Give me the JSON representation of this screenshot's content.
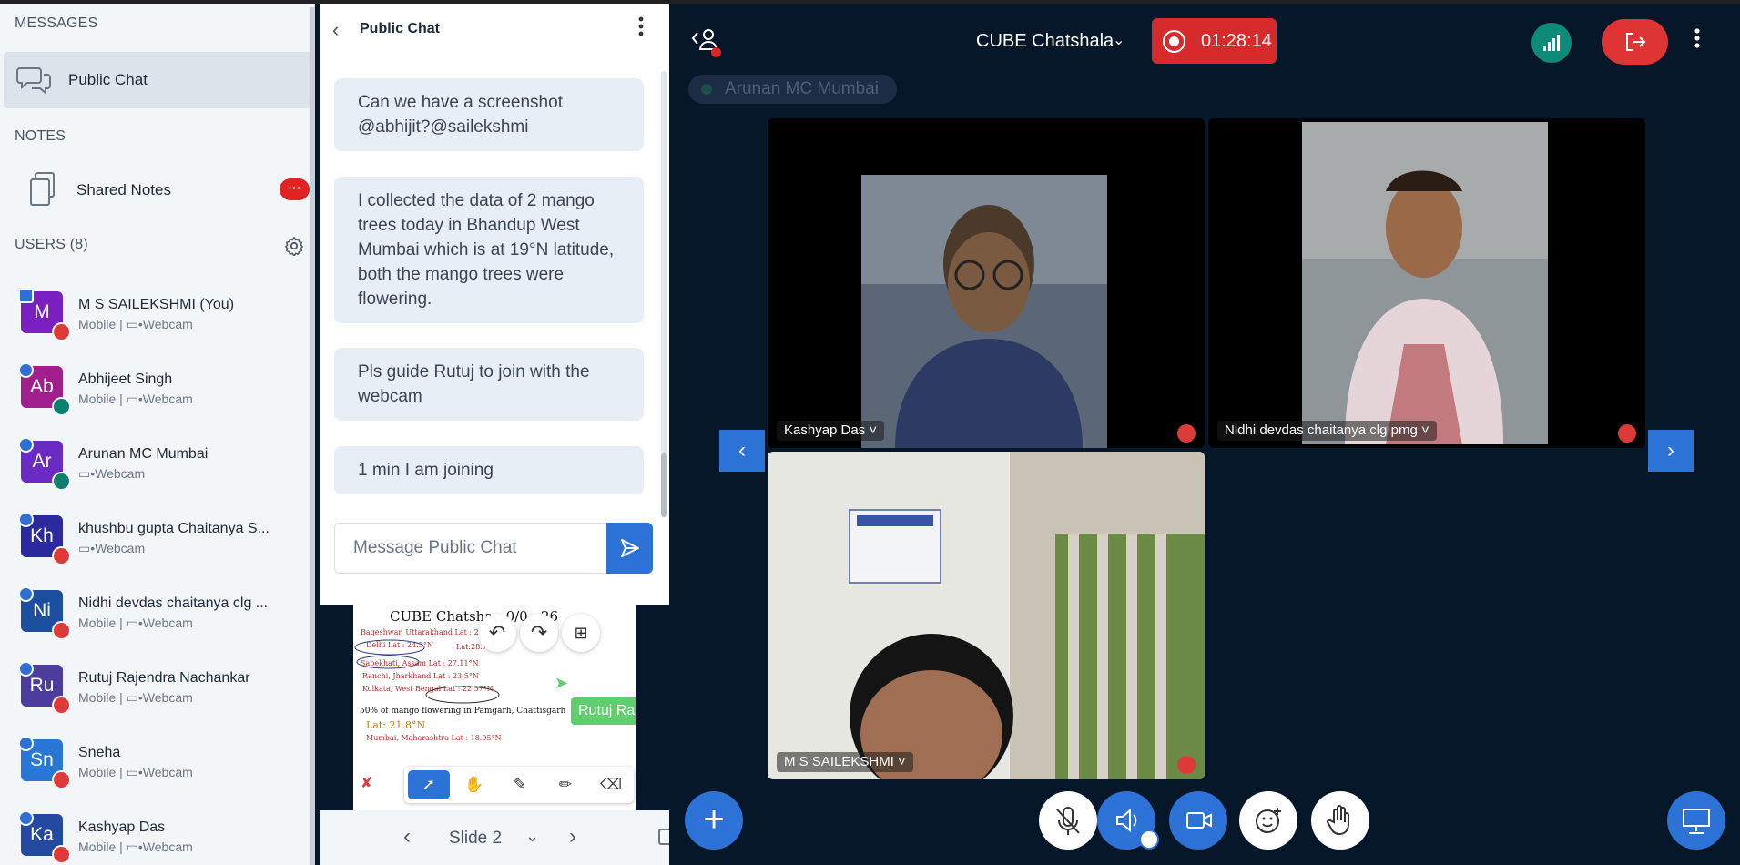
{
  "sidebar": {
    "messages_title": "MESSAGES",
    "public_chat_label": "Public Chat",
    "notes_title": "NOTES",
    "shared_notes_label": "Shared Notes",
    "shared_notes_badge": "···",
    "users_title": "USERS (8)",
    "users": [
      {
        "initials": "M",
        "name": "M S SAILEKSHMI (You)",
        "sub": "Mobile | ▭•Webcam",
        "color": "#7a1fc2",
        "mic": "muted"
      },
      {
        "initials": "Ab",
        "name": "Abhijeet Singh",
        "sub": "Mobile | ▭•Webcam",
        "color": "#a01f8c",
        "mic": "on"
      },
      {
        "initials": "Ar",
        "name": "Arunan MC Mumbai",
        "sub": "▭•Webcam",
        "color": "#6a2bc4",
        "mic": "on"
      },
      {
        "initials": "Kh",
        "name": "khushbu gupta Chaitanya S...",
        "sub": "▭•Webcam",
        "color": "#2a2a9e",
        "mic": "muted"
      },
      {
        "initials": "Ni",
        "name": "Nidhi devdas chaitanya clg ...",
        "sub": "Mobile | ▭•Webcam",
        "color": "#1d4fa0",
        "mic": "muted"
      },
      {
        "initials": "Ru",
        "name": "Rutuj Rajendra Nachankar",
        "sub": "Mobile | ▭•Webcam",
        "color": "#4b3c9e",
        "mic": "muted"
      },
      {
        "initials": "Sn",
        "name": "Sneha",
        "sub": "Mobile | ▭•Webcam",
        "color": "#2877d6",
        "mic": "muted"
      },
      {
        "initials": "Ka",
        "name": "Kashyap Das",
        "sub": "Mobile | ▭•Webcam",
        "color": "#2349a0",
        "mic": "muted"
      }
    ]
  },
  "chat": {
    "title": "Public Chat",
    "messages": [
      "Can we have a screenshot @abhijit?@sailekshmi",
      "I collected the data of 2 mango trees today in Bhandup West Mumbai which is at 19°N latitude, both the mango trees were flowering.",
      "Pls guide Rutuj to join with the webcam",
      "1 min I am joining"
    ],
    "input_placeholder": "Message Public Chat"
  },
  "presentation": {
    "slide_title": "CUBE Chatsha...0/0...26",
    "lines": [
      "Bageshwar, Uttarakhand Lat : 28.8°N",
      "Delhi Lat : 24.5°N",
      "Lat:28.7°N",
      "Sapekhati, Assam Lat : 27.11°N",
      "Ranchi, Jharkhand Lat : 23.5°N",
      "Kolkata, West Bengal Lat : 22.57°N",
      "50% of mango flowering in Pamgarh, Chattisgarh",
      "Lat: 21.8°N",
      "Mumbai, Maharashtra Lat : 18.95°N"
    ],
    "cursor_label": "Rutuj Ra",
    "slide_label": "Slide 2"
  },
  "meeting": {
    "title": "CUBE Chatshala",
    "recording_time": "01:28:14",
    "talking": "Arunan MC Mumbai"
  },
  "videos": [
    {
      "name": "Kashyap Das ˅"
    },
    {
      "name": "Nidhi devdas chaitanya clg pmg ˅"
    },
    {
      "name": "M S SAILEKSHMI ˅"
    }
  ],
  "colors": {
    "accent": "#2d72d6",
    "danger": "#df3434",
    "background": "#06172a",
    "connection": "#0e8a79"
  }
}
